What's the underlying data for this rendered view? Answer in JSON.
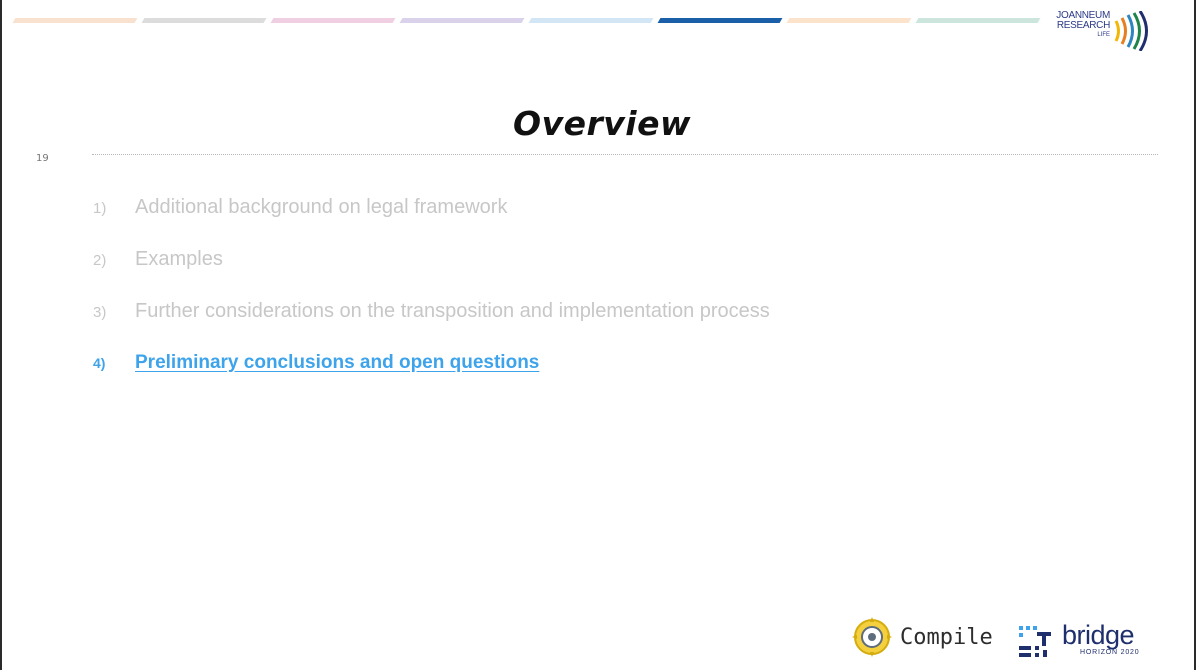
{
  "header": {
    "progress_segments": [
      {
        "color": "#f8e1cf"
      },
      {
        "color": "#dcdcdc"
      },
      {
        "color": "#f0cfe3"
      },
      {
        "color": "#d9d2ea"
      },
      {
        "color": "#d3e6f6"
      },
      {
        "color": "#1a5fa8"
      },
      {
        "color": "#fbe3cc"
      },
      {
        "color": "#cde6dd"
      }
    ],
    "active_segment": 5,
    "org_logo": {
      "line1": "JOANNEUM",
      "line2": "RESEARCH",
      "line3": "LIFE"
    }
  },
  "slide": {
    "number": "19",
    "title": "Overview"
  },
  "agenda": [
    {
      "num": "1)",
      "label": "Additional background on legal framework",
      "active": false
    },
    {
      "num": "2)",
      "label": "Examples",
      "active": false
    },
    {
      "num": "3)",
      "label": "Further considerations on the transposition and implementation process",
      "active": false
    },
    {
      "num": "4)",
      "label": "Preliminary conclusions and open questions",
      "active": true
    }
  ],
  "footer": {
    "compile_logo": "Compile",
    "bridge_logo": {
      "word": "bridge",
      "sub": "HORIZON 2020"
    }
  },
  "colors": {
    "active_item": "#3da3ea",
    "inactive_item": "#c7c7c7",
    "title": "#111111"
  }
}
